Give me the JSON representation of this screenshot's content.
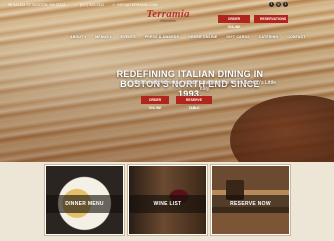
{
  "colors": {
    "brand_red": "#b0261c",
    "logo_red": "#b8322a",
    "page_bg": "#ede6d6"
  },
  "topbar": {
    "address": "98 SALEM ST. BOSTON, MA 02113",
    "phone": "(617) 523-3112",
    "email": "INFO@TERRAMIA.COM",
    "social": [
      {
        "icon": "facebook-icon",
        "glyph": "f"
      },
      {
        "icon": "instagram-icon",
        "glyph": "◎"
      },
      {
        "icon": "twitter-icon",
        "glyph": "t"
      }
    ]
  },
  "logo": {
    "name": "Terramia",
    "sub": "Ristorante"
  },
  "header_buttons": {
    "order": "ORDER ONLINE",
    "reserve": "RESERVATIONS"
  },
  "nav": {
    "items": [
      {
        "label": "ABOUT",
        "dropdown": true
      },
      {
        "label": "MENUS",
        "dropdown": true
      },
      {
        "label": "EVENTS",
        "dropdown": false
      },
      {
        "label": "PRESS & AWARDS",
        "dropdown": false
      },
      {
        "label": "ORDER ONLINE",
        "dropdown": false
      },
      {
        "label": "GIFT CARDS",
        "dropdown": false
      },
      {
        "label": "CATERING",
        "dropdown": false
      },
      {
        "label": "CONTACT",
        "dropdown": false
      }
    ]
  },
  "hero": {
    "headline_1": "REDEFINING ITALIAN DINING IN",
    "headline_2": "BOSTON'S NORTH END SINCE 1993.",
    "tagline": "Seasonally, inventive italian cuisine in the heart Boston's Little Italy.",
    "order_label": "ORDER ONLINE",
    "reserve_label": "RESERVE TABLE"
  },
  "cards": [
    {
      "label": "DINNER MENU"
    },
    {
      "label": "WINE LIST"
    },
    {
      "label": "RESERVE NOW"
    }
  ]
}
